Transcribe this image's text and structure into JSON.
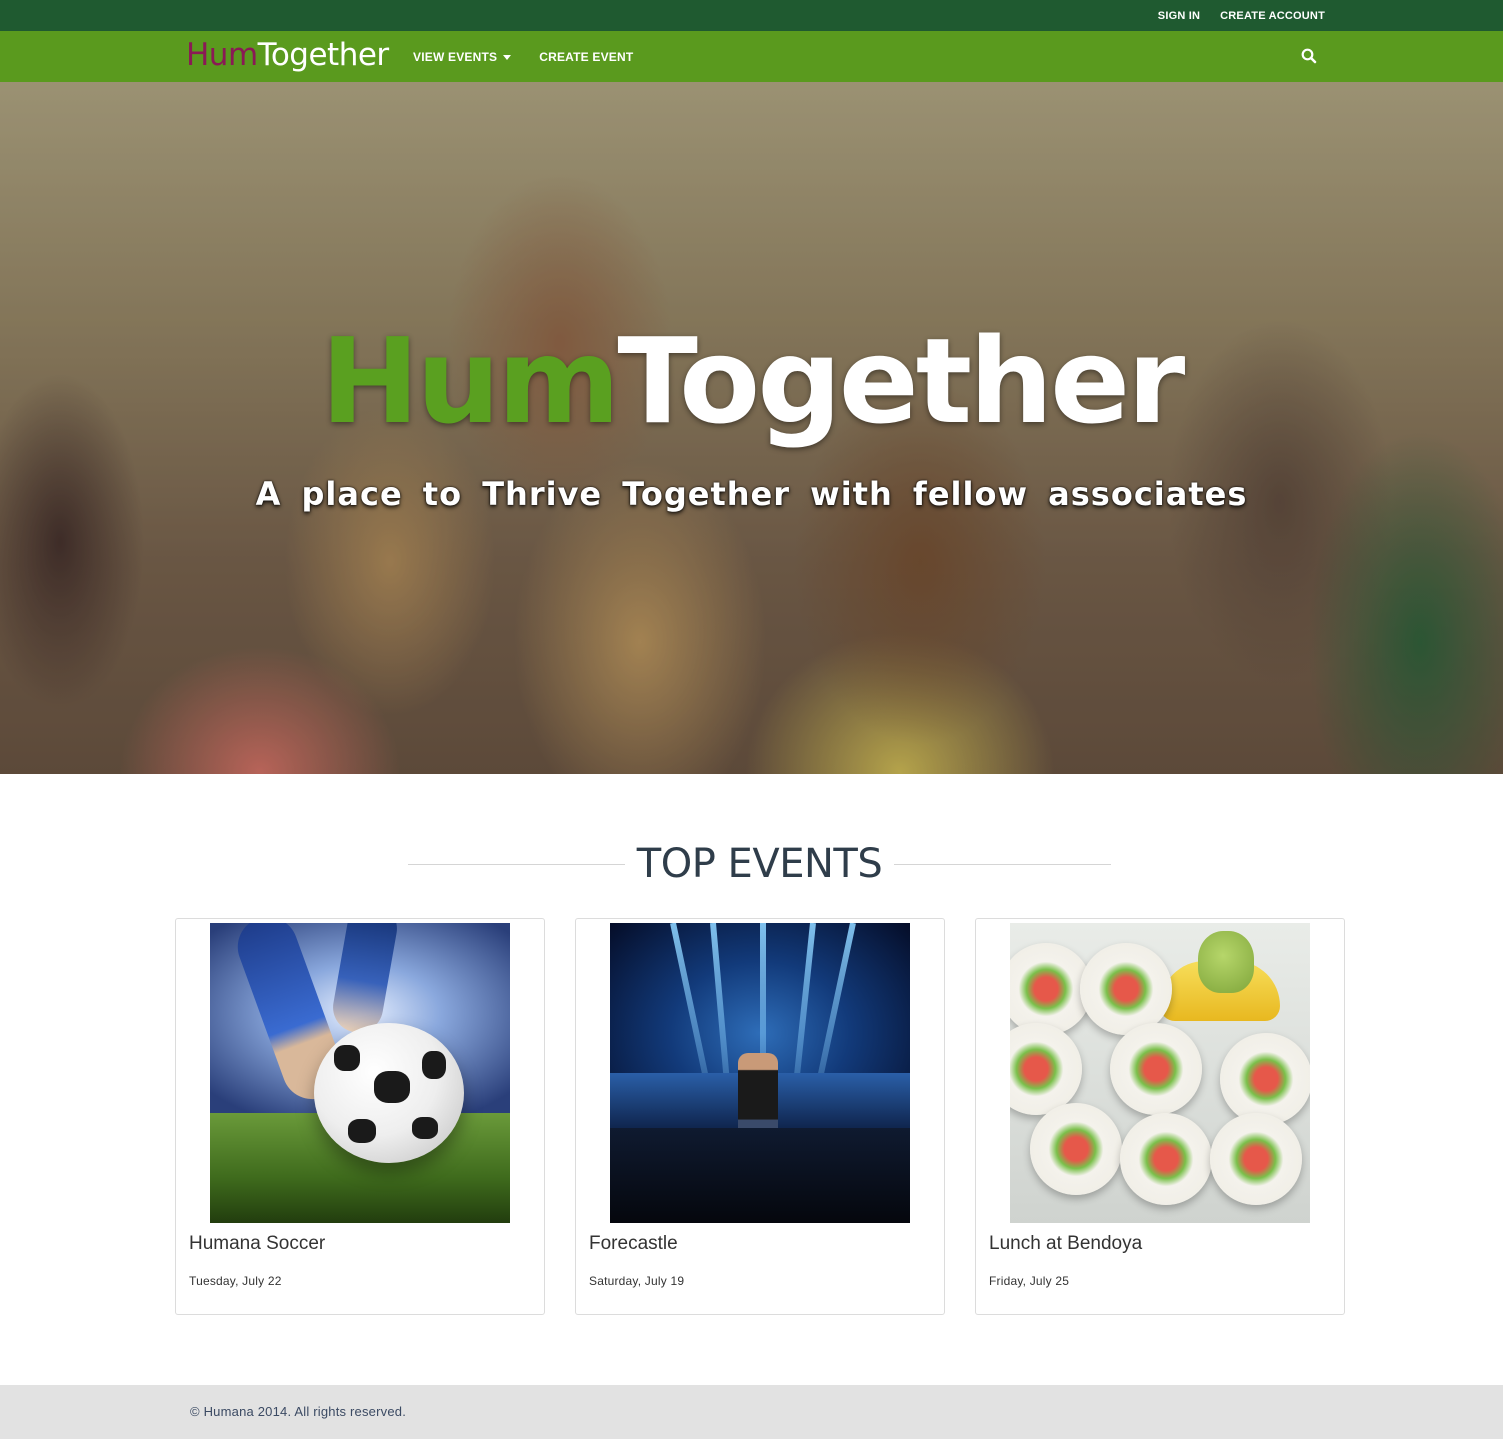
{
  "utility_nav": {
    "sign_in": "SIGN IN",
    "create_account": "CREATE ACCOUNT"
  },
  "nav": {
    "logo": {
      "part1": "Hum",
      "part2": "Together"
    },
    "view_events": "VIEW EVENTS",
    "create_event": "CREATE EVENT",
    "search_icon": "search-icon"
  },
  "hero": {
    "title_part1": "Hum",
    "title_part2": "Together",
    "tagline": "A place to Thrive Together with fellow associates"
  },
  "top_events": {
    "heading": "TOP EVENTS",
    "events": [
      {
        "title": "Humana Soccer",
        "date": "Tuesday, July 22",
        "image": "soccer-ball"
      },
      {
        "title": "Forecastle",
        "date": "Saturday, July 19",
        "image": "concert"
      },
      {
        "title": "Lunch at Bendoya",
        "date": "Friday, July 25",
        "image": "sushi"
      }
    ]
  },
  "footer": {
    "copyright": "© Humana 2014. All rights reserved."
  },
  "colors": {
    "utility_bar": "#1f5a30",
    "nav_bar": "#5a9a1e",
    "logo_hum": "#8a1a55",
    "hero_hum": "#5aa020",
    "footer_bg": "#e2e2e2"
  }
}
